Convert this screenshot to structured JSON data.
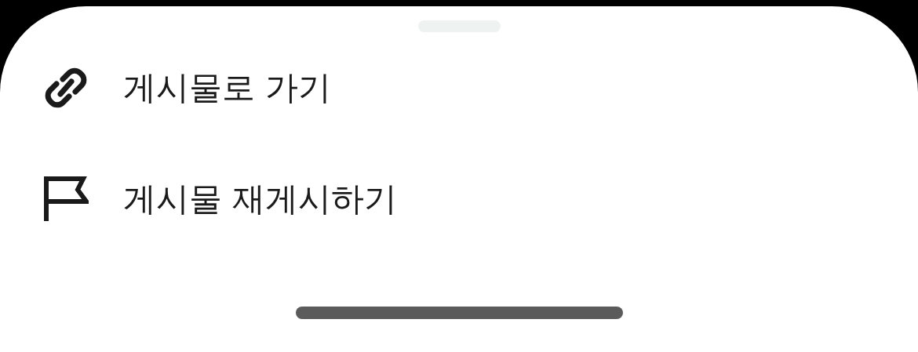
{
  "items": [
    {
      "kind": "link",
      "label": "게시물로 가기"
    },
    {
      "kind": "flag",
      "label": "게시물 재게시하기"
    }
  ]
}
